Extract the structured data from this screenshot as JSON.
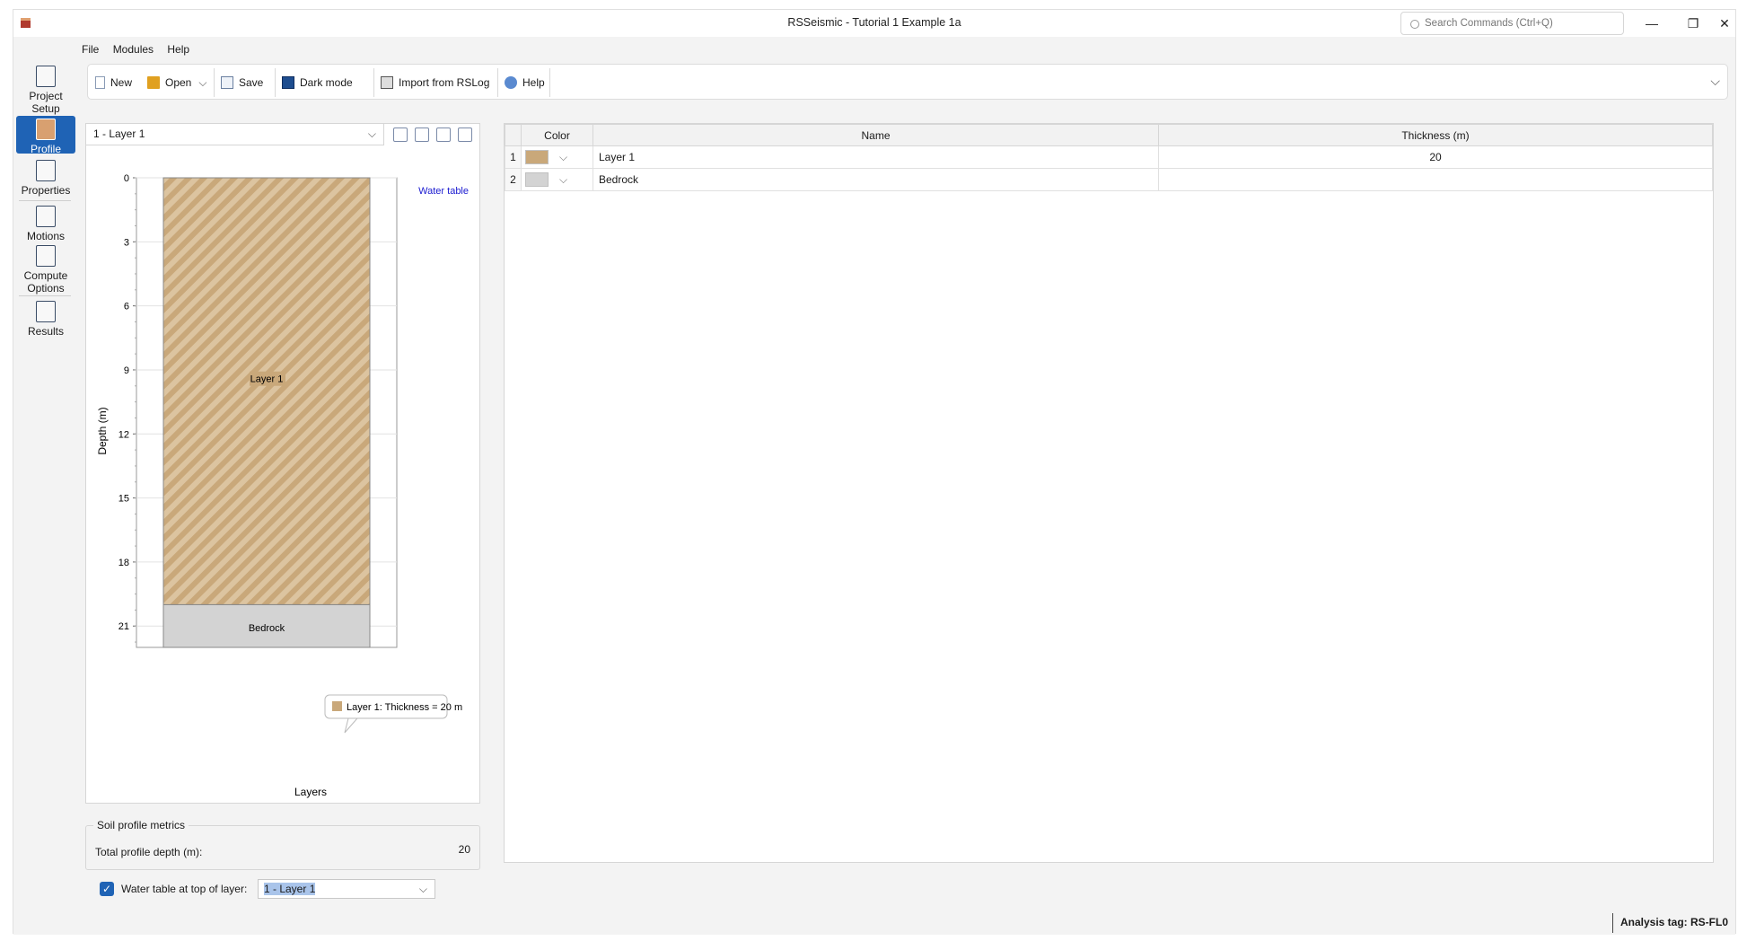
{
  "window": {
    "title": "RSSeismic - Tutorial 1 Example 1a",
    "search_placeholder": "Search Commands (Ctrl+Q)",
    "controls": {
      "minimize": "—",
      "restore": "❐",
      "close": "✕"
    }
  },
  "menu": [
    "File",
    "Modules",
    "Help"
  ],
  "toolbar": {
    "new": "New",
    "open": "Open",
    "save": "Save",
    "dark_mode": "Dark mode",
    "import": "Import from RSLog",
    "help": "Help"
  },
  "sidebar": [
    {
      "label": "Project Setup",
      "icon": "project-setup-icon",
      "active": false
    },
    {
      "label": "Profile",
      "icon": "profile-icon",
      "active": true
    },
    {
      "label": "Properties",
      "icon": "properties-icon",
      "active": false
    },
    {
      "label": "Motions",
      "icon": "motions-icon",
      "active": false
    },
    {
      "label": "Compute Options",
      "icon": "compute-options-icon",
      "active": false
    },
    {
      "label": "Results",
      "icon": "results-icon",
      "active": false
    }
  ],
  "profile_panel": {
    "layer_select": "1 - Layer 1"
  },
  "chart_data": {
    "type": "bar",
    "ylabel": "Depth (m)",
    "xlabel": "Layers",
    "ylim": [
      0,
      22
    ],
    "y_ticks": [
      0,
      3,
      6,
      9,
      12,
      15,
      18,
      21
    ],
    "y_inverted": true,
    "layers": [
      {
        "name": "Layer 1",
        "top": 0,
        "bottom": 20,
        "color": "#c9a87a"
      },
      {
        "name": "Bedrock",
        "top": 20,
        "bottom": 22,
        "color": "#d3d3d3"
      }
    ],
    "annotation": "Water table",
    "tooltip": "Layer 1: Thickness = 20 m"
  },
  "metrics": {
    "title": "Soil profile metrics",
    "total_depth_label": "Total profile depth (m):",
    "total_depth_value": "20"
  },
  "water_table": {
    "checked": true,
    "label": "Water table at top of layer:",
    "value": "1 - Layer 1"
  },
  "table": {
    "headers": [
      "Color",
      "Name",
      "Thickness (m)"
    ],
    "rows": [
      {
        "index": "1",
        "color": "#c9a87a",
        "name": "Layer 1",
        "thickness": "20"
      },
      {
        "index": "2",
        "color": "#d3d3d3",
        "name": "Bedrock",
        "thickness": ""
      }
    ]
  },
  "status": {
    "analysis_tag": "Analysis tag: RS-FL0"
  }
}
